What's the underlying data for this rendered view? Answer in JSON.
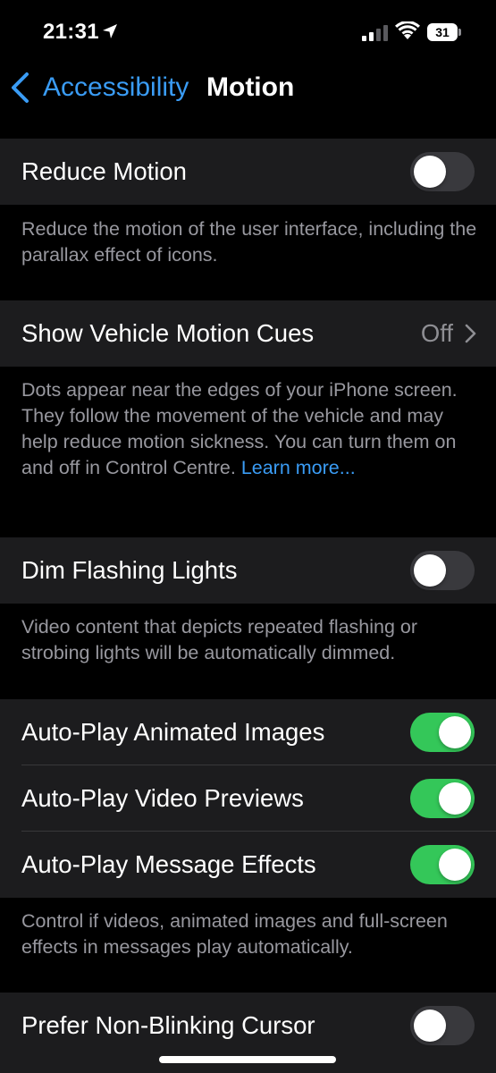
{
  "status_bar": {
    "time": "21:31",
    "battery": "31",
    "icons": [
      "location-arrow-icon",
      "cellular-signal-icon",
      "wifi-icon",
      "battery-icon"
    ]
  },
  "nav": {
    "back_label": "Accessibility",
    "title": "Motion"
  },
  "reduce_motion": {
    "label": "Reduce Motion",
    "on": false,
    "footer": "Reduce the motion of the user interface, including the parallax effect of icons."
  },
  "vehicle_cues": {
    "label": "Show Vehicle Motion Cues",
    "value": "Off",
    "footer": "Dots appear near the edges of your iPhone screen. They follow the movement of the vehicle and may help reduce motion sickness. You can turn them on and off in Control Centre.",
    "link": "Learn more..."
  },
  "dim_flashing": {
    "label": "Dim Flashing Lights",
    "on": false,
    "footer": "Video content that depicts repeated flashing or strobing lights will be automatically dimmed."
  },
  "autoplay": {
    "items": [
      {
        "label": "Auto-Play Animated Images",
        "on": true
      },
      {
        "label": "Auto-Play Video Previews",
        "on": true
      },
      {
        "label": "Auto-Play Message Effects",
        "on": true
      }
    ],
    "footer": "Control if videos, animated images and full-screen effects in messages play automatically."
  },
  "cursor": {
    "label": "Prefer Non-Blinking Cursor",
    "on": false
  },
  "colors": {
    "accent": "#3a9cf5",
    "toggle_on": "#34c759",
    "toggle_off": "#39393d",
    "group_bg": "#1c1c1e"
  }
}
